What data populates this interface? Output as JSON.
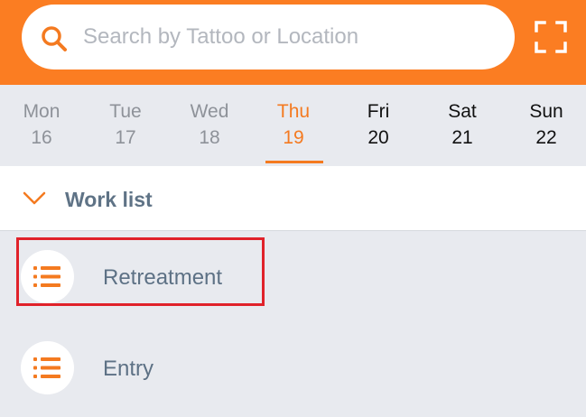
{
  "search": {
    "placeholder": "Search by Tattoo or Location",
    "icon": "search-icon",
    "scan_icon": "scan-icon"
  },
  "week": {
    "days": [
      {
        "name": "Mon",
        "date": "16",
        "state": "past"
      },
      {
        "name": "Tue",
        "date": "17",
        "state": "past"
      },
      {
        "name": "Wed",
        "date": "18",
        "state": "past"
      },
      {
        "name": "Thu",
        "date": "19",
        "state": "selected"
      },
      {
        "name": "Fri",
        "date": "20",
        "state": "future"
      },
      {
        "name": "Sat",
        "date": "21",
        "state": "future"
      },
      {
        "name": "Sun",
        "date": "22",
        "state": "future"
      }
    ]
  },
  "worklist": {
    "title": "Work list",
    "items": [
      {
        "label": "Retreatment",
        "icon": "list-icon"
      },
      {
        "label": "Entry",
        "icon": "list-icon"
      }
    ]
  },
  "colors": {
    "accent": "#fb7d22",
    "selected_day": "#f47a20",
    "highlight": "#e0222a",
    "label": "#5d7185"
  }
}
